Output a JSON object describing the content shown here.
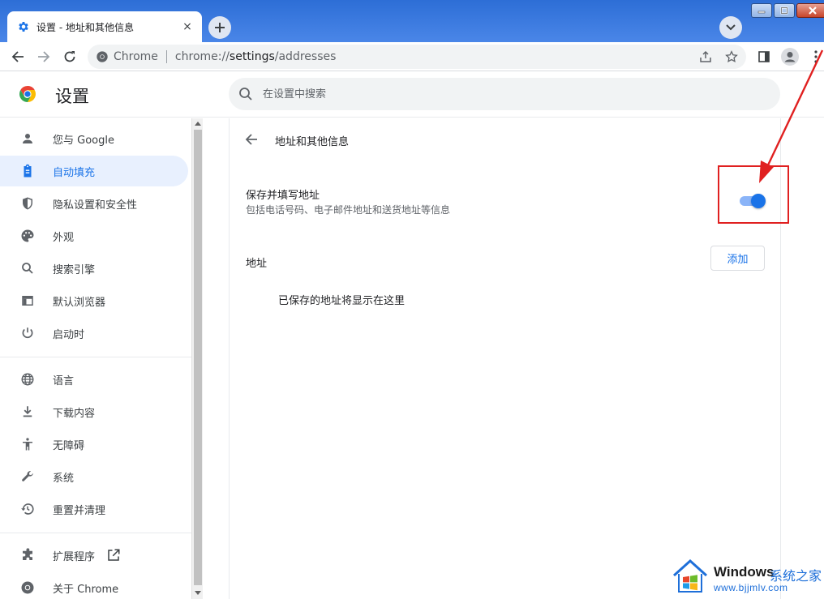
{
  "tab": {
    "title": "设置 - 地址和其他信息",
    "close": "×"
  },
  "toolbar": {
    "site_label": "Chrome",
    "url_scheme": "chrome://",
    "url_host": "settings",
    "url_path": "/addresses"
  },
  "settings": {
    "title": "设置",
    "search_placeholder": "在设置中搜索"
  },
  "sidebar": {
    "items": [
      {
        "label": "您与 Google",
        "icon": "person-icon"
      },
      {
        "label": "自动填充",
        "icon": "clipboard-icon",
        "active": true
      },
      {
        "label": "隐私设置和安全性",
        "icon": "shield-icon"
      },
      {
        "label": "外观",
        "icon": "palette-icon"
      },
      {
        "label": "搜索引擎",
        "icon": "search-icon"
      },
      {
        "label": "默认浏览器",
        "icon": "browser-icon"
      },
      {
        "label": "启动时",
        "icon": "power-icon"
      },
      {
        "label": "语言",
        "icon": "globe-icon"
      },
      {
        "label": "下载内容",
        "icon": "download-icon"
      },
      {
        "label": "无障碍",
        "icon": "accessibility-icon"
      },
      {
        "label": "系统",
        "icon": "wrench-icon"
      },
      {
        "label": "重置并清理",
        "icon": "history-icon"
      },
      {
        "label": "扩展程序",
        "icon": "puzzle-icon"
      },
      {
        "label": "关于 Chrome",
        "icon": "chrome-icon"
      }
    ]
  },
  "main": {
    "page_title": "地址和其他信息",
    "save_fill_title": "保存并填写地址",
    "save_fill_subtitle": "包括电话号码、电子邮件地址和送货地址等信息",
    "save_fill_enabled": true,
    "addresses_label": "地址",
    "add_button": "添加",
    "empty_message": "已保存的地址将显示在这里"
  },
  "watermark": {
    "brand": "Windows",
    "brand_cn": "系统之家",
    "site": "www.bjjmlv.com"
  },
  "colors": {
    "accent": "#1a73e8",
    "annotation": "#e02020",
    "titlebar": "#3b78dc"
  }
}
